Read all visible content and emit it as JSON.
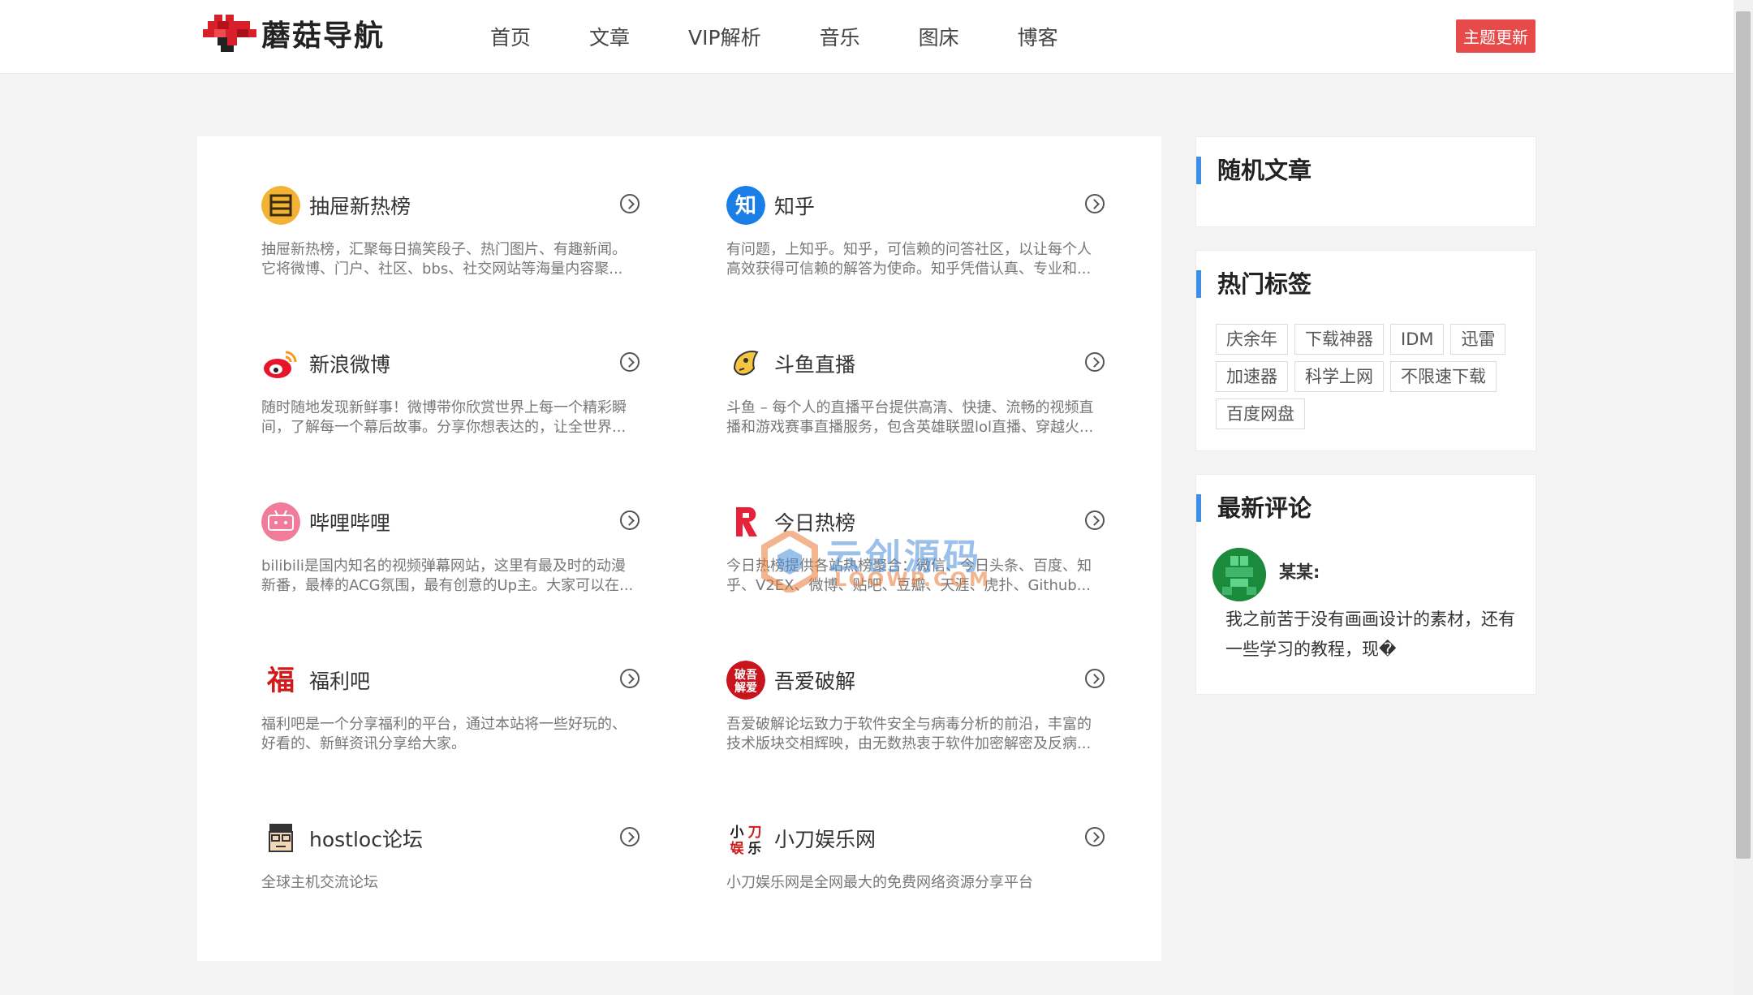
{
  "header": {
    "logo_text": "蘑菇导航",
    "nav": [
      "首页",
      "文章",
      "VIP解析",
      "音乐",
      "图床",
      "博客"
    ],
    "update_button": "主题更新"
  },
  "sites": [
    {
      "name": "抽屉新热榜",
      "desc": "抽屉新热榜，汇聚每日搞笑段子、热门图片、有趣新闻。它将微博、门户、社区、bbs、社交网站等海量内容聚...",
      "icon": "drawer-icon"
    },
    {
      "name": "知乎",
      "desc": "有问题，上知乎。知乎，可信赖的问答社区，以让每个人高效获得可信赖的解答为使命。知乎凭借认真、专业和...",
      "icon": "zhihu-icon"
    },
    {
      "name": "新浪微博",
      "desc": "随时随地发现新鲜事！微博带你欣赏世界上每一个精彩瞬间，了解每一个幕后故事。分享你想表达的，让全世界...",
      "icon": "weibo-icon"
    },
    {
      "name": "斗鱼直播",
      "desc": "斗鱼 – 每个人的直播平台提供高清、快捷、流畅的视频直播和游戏赛事直播服务，包含英雄联盟lol直播、穿越火...",
      "icon": "douyu-icon"
    },
    {
      "name": "哔哩哔哩",
      "desc": "bilibili是国内知名的视频弹幕网站，这里有最及时的动漫新番，最棒的ACG氛围，最有创意的Up主。大家可以在...",
      "icon": "bilibili-icon"
    },
    {
      "name": "今日热榜",
      "desc": "今日热榜提供各站热榜聚合：微信、今日头条、百度、知乎、V2EX、微博、贴吧、豆瓣、天涯、虎扑、Github...",
      "icon": "tophub-icon"
    },
    {
      "name": "福利吧",
      "desc": "福利吧是一个分享福利的平台，通过本站将一些好玩的、好看的、新鲜资讯分享给大家。",
      "icon": "fuli-icon"
    },
    {
      "name": "吾爱破解",
      "desc": "吾爱破解论坛致力于软件安全与病毒分析的前沿，丰富的技术版块交相辉映，由无数热衷于软件加密解密及反病...",
      "icon": "52pojie-icon"
    },
    {
      "name": "hostloc论坛",
      "desc": "全球主机交流论坛",
      "icon": "hostloc-icon"
    },
    {
      "name": "小刀娱乐网",
      "desc": "小刀娱乐网是全网最大的免费网络资源分享平台",
      "icon": "xiaodao-icon"
    }
  ],
  "sidebar": {
    "random_title": "随机文章",
    "tags_title": "热门标签",
    "tags": [
      "庆余年",
      "下载神器",
      "IDM",
      "迅雷",
      "加速器",
      "科学上网",
      "不限速下载",
      "百度网盘"
    ],
    "comments_title": "最新评论",
    "comment": {
      "user": "某某:",
      "text": "我之前苦于没有画画设计的素材，还有一些学习的教程，现�"
    }
  },
  "watermark": {
    "text": "云创源码",
    "sub": "LOOWP.COM"
  },
  "colors": {
    "accent": "#3d8fe6",
    "update_button": "#e84a4a",
    "logo_red": "#d6202a"
  }
}
